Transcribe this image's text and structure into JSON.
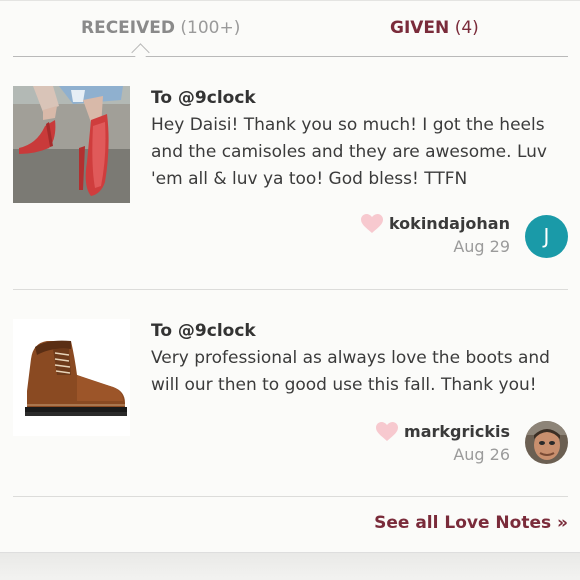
{
  "tabs": {
    "received_label": "RECEIVED",
    "received_count": "(100+)",
    "given_label": "GIVEN",
    "given_count": "(4)"
  },
  "notes": [
    {
      "to": "To @9clock",
      "message": "Hey Daisi! Thank you so much! I got the heels and the camisoles and they are awesome. Luv 'em all & luv ya too! God bless! TTFN",
      "username": "kokindajohan",
      "date": "Aug 29",
      "avatar_letter": "J",
      "image": "red-heels-photo"
    },
    {
      "to": "To @9clock",
      "message": "Very professional as always love the boots and will our then to good use this fall. Thank you!",
      "username": "markgrickis",
      "date": "Aug 26",
      "image": "brown-boot-photo"
    }
  ],
  "see_all_label": "See all Love Notes »",
  "colors": {
    "accent": "#7a2b3a",
    "heart": "#f7c9cf",
    "avatar_teal": "#1a9aa8"
  }
}
